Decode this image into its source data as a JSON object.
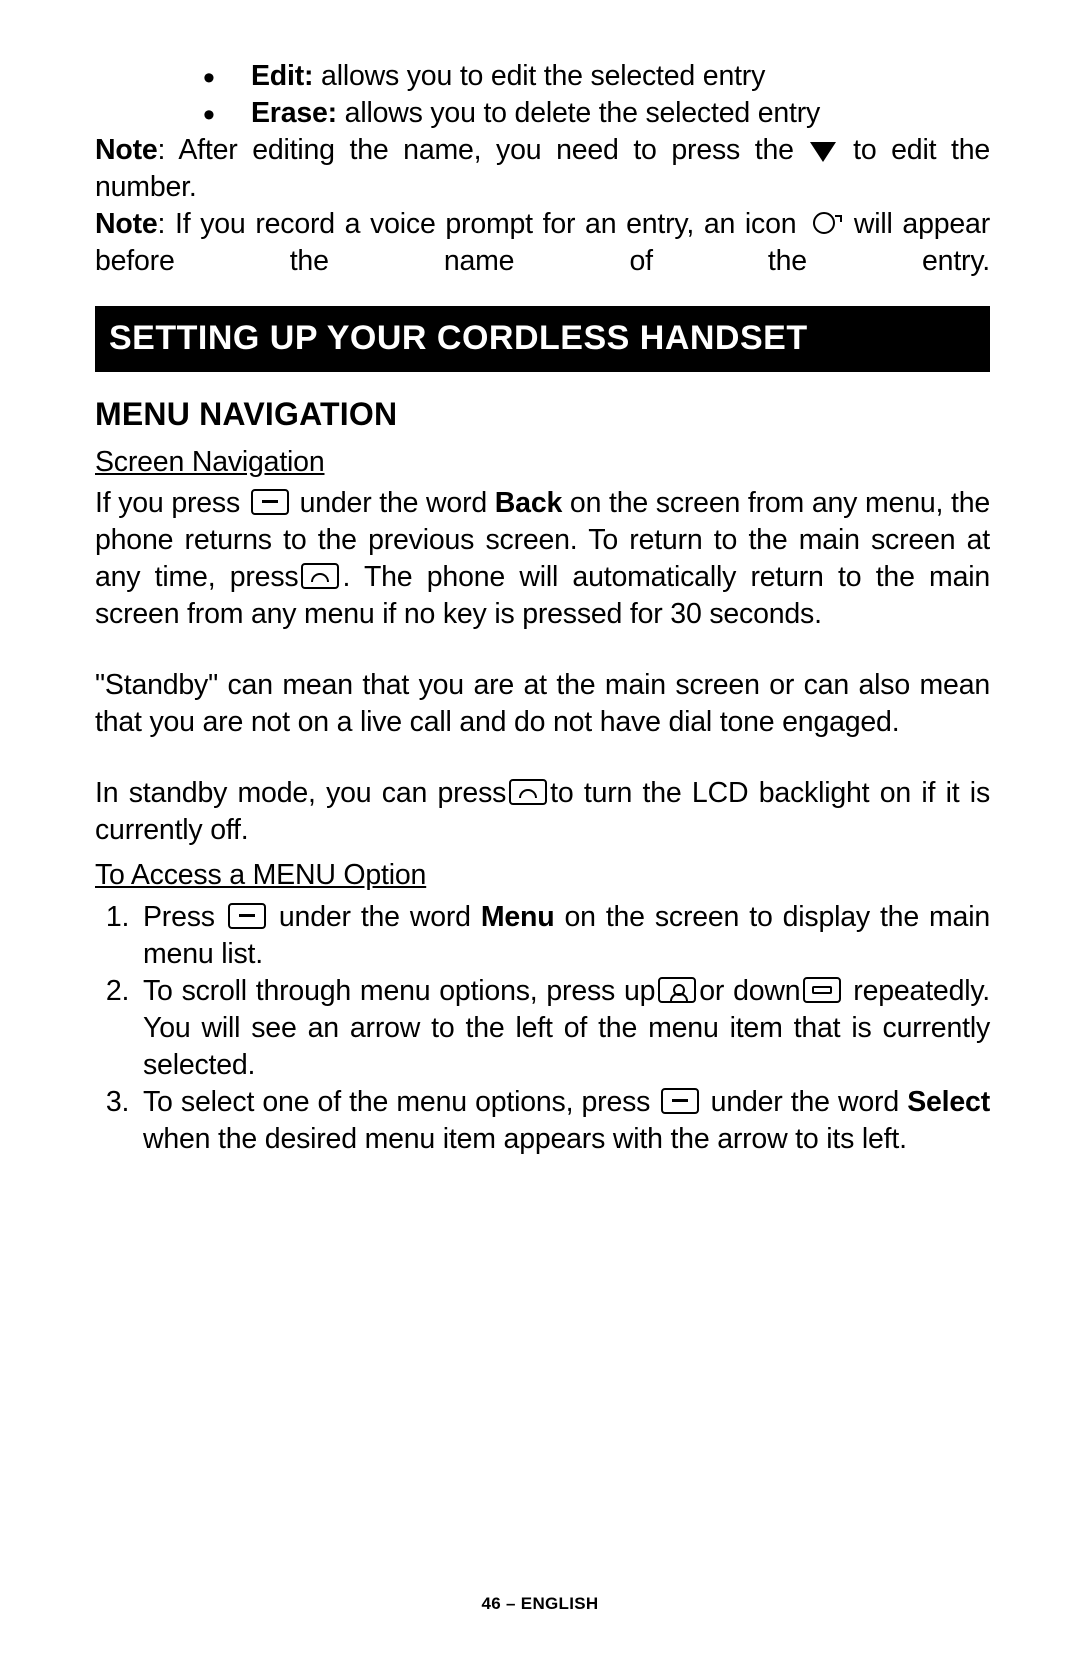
{
  "bullets": {
    "edit_label": "Edit:",
    "edit_desc": " allows you to edit the selected entry",
    "erase_label": "Erase:",
    "erase_desc": " allows you to delete the selected entry"
  },
  "note1_pre": "Note",
  "note1_a": ": After editing the name, you need to press the",
  "note1_b": "to edit the number.",
  "note2_pre": "Note",
  "note2_a": ": If you record a voice prompt for an entry, an icon ",
  "note2_b": " will appear before the name of the entry.",
  "section_bar": "SETTING UP YOUR CORDLESS HANDSET",
  "subhead": "MENU NAVIGATION",
  "screen_nav_h": "Screen Navigation",
  "p1_a": "If you press ",
  "p1_b": " under the word ",
  "p1_back": "Back",
  "p1_c": " on the screen from any menu, the phone returns to the previous screen. To return to the main screen at any time, press",
  "p1_d": ". The phone will automatically return to the main screen from any menu if no key is pressed for 30 seconds.",
  "p2": "\"Standby\" can mean that you are at the main screen or can also mean that you are not on a live call and do not have dial tone engaged.",
  "p3_a": "In standby mode, you can press",
  "p3_b": "to turn the LCD backlight on if it is currently off.",
  "access_h": "To Access a MENU Option",
  "steps": {
    "s1_a": "Press ",
    "s1_b": " under the word ",
    "s1_menu": "Menu",
    "s1_c": " on the screen to display the main menu list.",
    "s2_a": "To scroll through menu options, press up",
    "s2_b": "or down",
    "s2_c": " repeatedly.  You will see an arrow to the left of the menu item that is currently selected.",
    "s3_a": "To select one of the menu options, press ",
    "s3_b": " under the word ",
    "s3_select": "Select",
    "s3_c": " when the desired menu item appears with the arrow to its left."
  },
  "footer": "46 – ENGLISH"
}
